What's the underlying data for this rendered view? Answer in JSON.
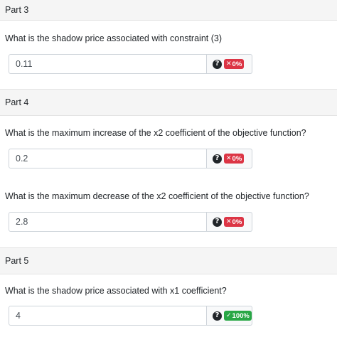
{
  "parts": [
    {
      "title": "Part 3"
    },
    {
      "title": "Part 4"
    },
    {
      "title": "Part 5"
    }
  ],
  "questions": [
    {
      "text": "What is the shadow price associated with constraint (3)",
      "answer": "0.11",
      "score": "0%",
      "status": "incorrect",
      "status_icon": "times-icon"
    },
    {
      "text": "What is the maximum increase of the x2 coefficient of the objective function?",
      "answer": "0.2",
      "score": "0%",
      "status": "incorrect",
      "status_icon": "times-icon"
    },
    {
      "text": "What is the maximum decrease of the x2 coefficient of the objective function?",
      "answer": "2.8",
      "score": "0%",
      "status": "incorrect",
      "status_icon": "times-icon"
    },
    {
      "text": "What is the shadow price associated with x1 coefficient?",
      "answer": "4",
      "score": "100%",
      "status": "correct",
      "status_icon": "check-icon"
    }
  ],
  "help_icon": "question-circle-icon",
  "colors": {
    "incorrect": "#dc3545",
    "correct": "#28a745",
    "header_bg": "#f5f5f5"
  }
}
